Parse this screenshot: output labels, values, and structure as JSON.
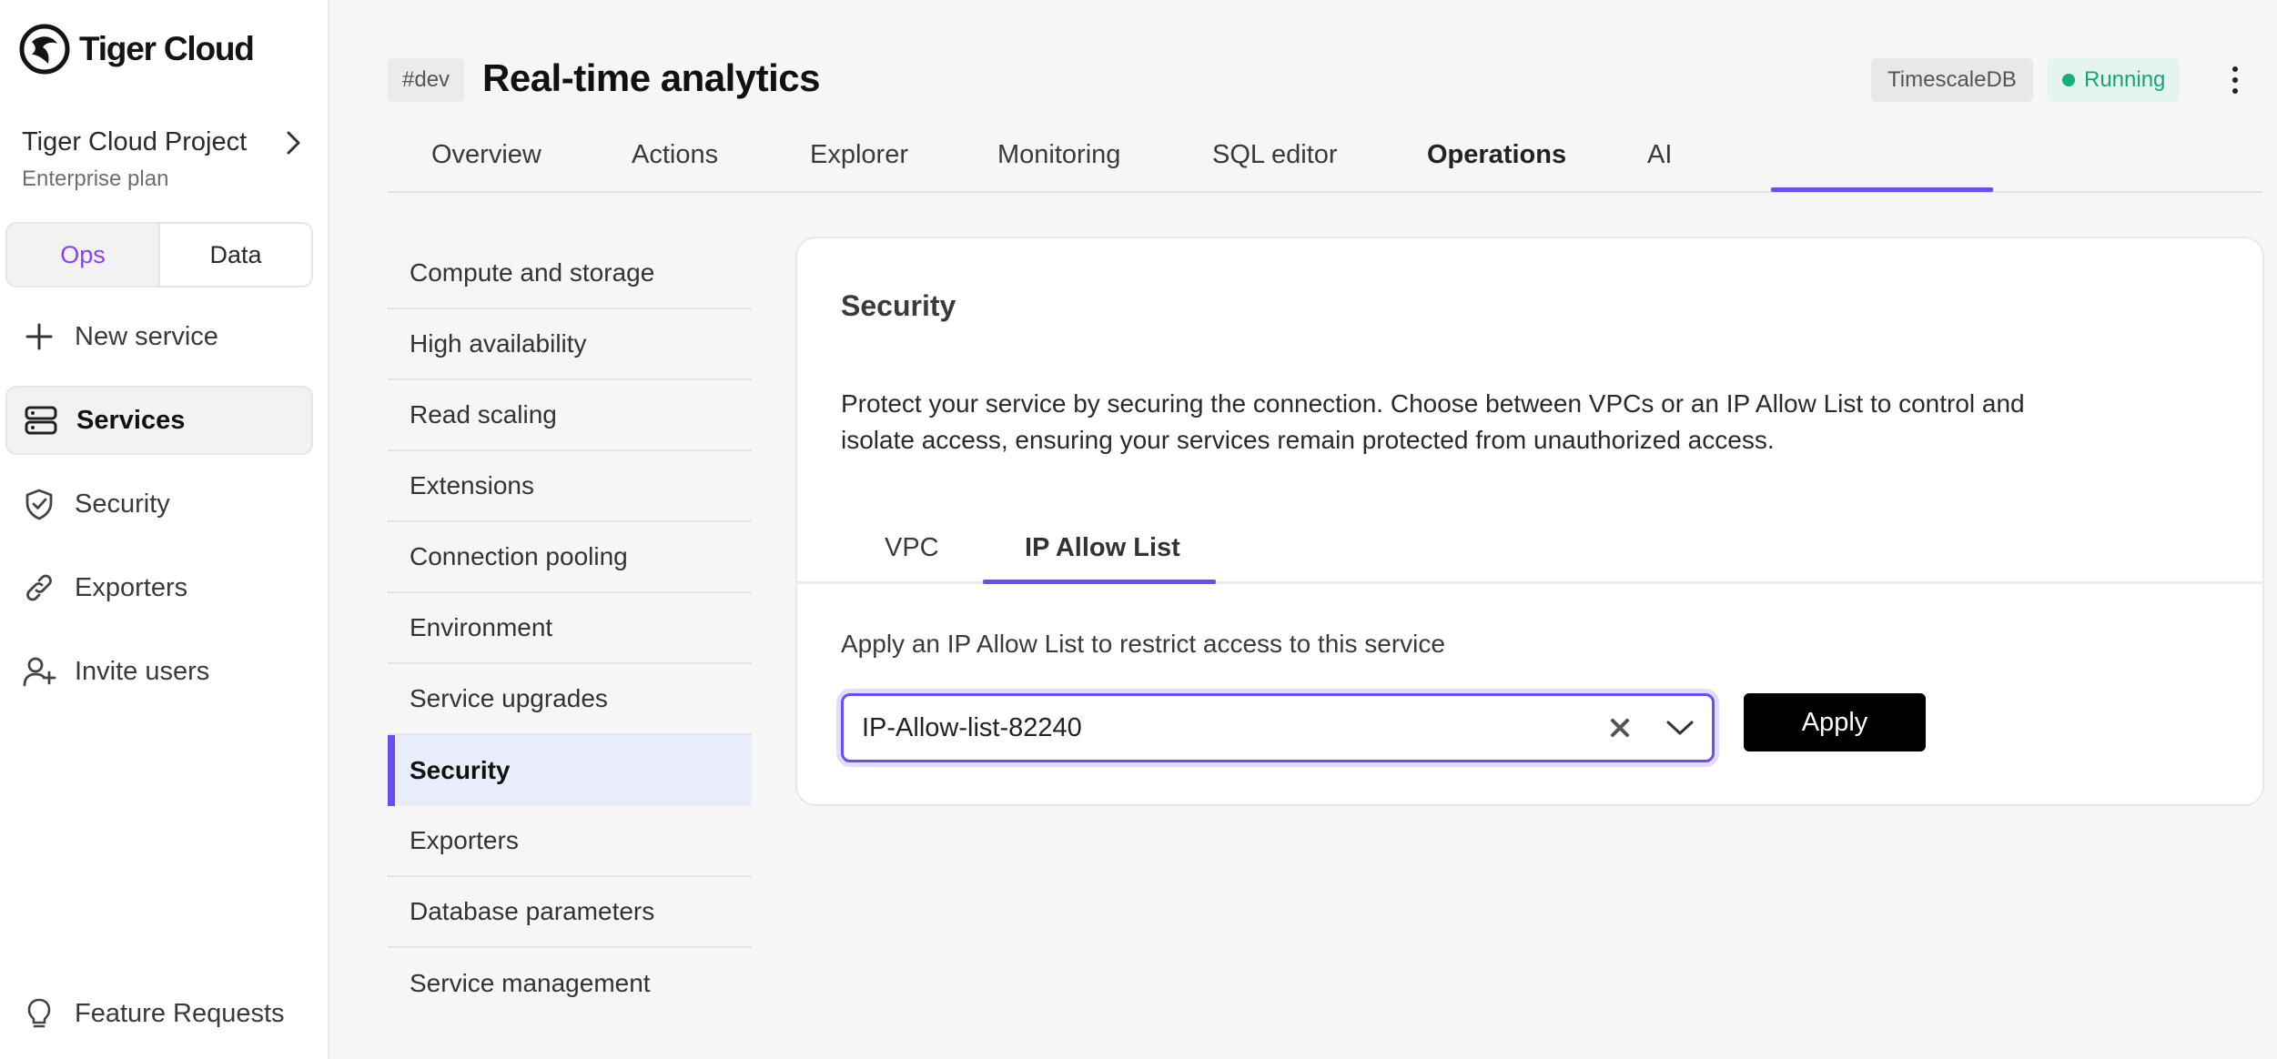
{
  "app": {
    "brand": "Tiger Cloud",
    "logo_icon": "tiger-logo-icon"
  },
  "project": {
    "name": "Tiger Cloud Project",
    "plan": "Enterprise plan"
  },
  "mode_switch": {
    "options": [
      "Ops",
      "Data"
    ],
    "selected": "Ops",
    "accent_color": "#8a3ffc"
  },
  "sidebar": {
    "items": [
      {
        "label": "New service",
        "icon": "plus-icon",
        "active": false
      },
      {
        "label": "Services",
        "icon": "server-icon",
        "active": true
      },
      {
        "label": "Security",
        "icon": "shield-check-icon",
        "active": false
      },
      {
        "label": "Exporters",
        "icon": "link-icon",
        "active": false
      },
      {
        "label": "Invite users",
        "icon": "user-plus-icon",
        "active": false
      }
    ],
    "footer": {
      "label": "Feature Requests",
      "icon": "lightbulb-icon"
    }
  },
  "header": {
    "env_tag": "#dev",
    "title": "Real-time analytics",
    "engine_badge": "TimescaleDB",
    "status": "Running",
    "status_color": "#17a673"
  },
  "tabs": [
    "Overview",
    "Actions",
    "Explorer",
    "Monitoring",
    "SQL editor",
    "Operations",
    "AI"
  ],
  "active_tab": "Operations",
  "subnav": {
    "items": [
      "Compute and storage",
      "High availability",
      "Read scaling",
      "Extensions",
      "Connection pooling",
      "Environment",
      "Service upgrades",
      "Security",
      "Exporters",
      "Database parameters",
      "Service management"
    ],
    "active": "Security"
  },
  "security": {
    "title": "Security",
    "description": "Protect your service by securing the connection. Choose between VPCs or an IP Allow List to control and isolate access, ensuring your services remain protected from unauthorized access.",
    "tabs": [
      "VPC",
      "IP Allow List"
    ],
    "active_tab": "IP Allow List",
    "apply_label": "Apply an IP Allow List to restrict access to this service",
    "selected_list": "IP-Allow-list-82240",
    "apply_button": "Apply",
    "accent_color": "#6a4df5"
  }
}
